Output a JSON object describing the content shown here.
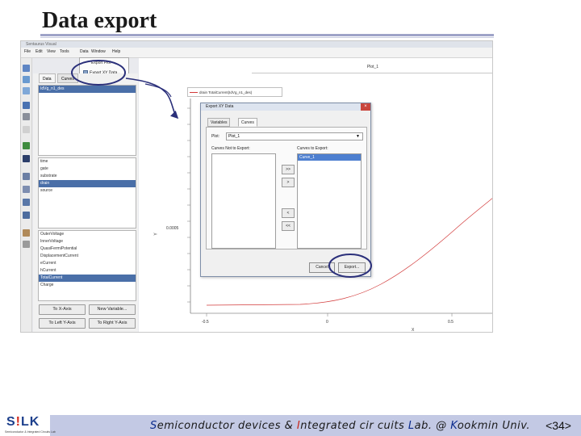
{
  "slide": {
    "title": "Data export",
    "page_number": "<34>"
  },
  "window": {
    "title": "Sentaurus Visual",
    "menu": [
      "File",
      "Edit",
      "View",
      "Tools",
      "Data",
      "Window",
      "Help"
    ],
    "data_menu": {
      "item_1": "Export Plot",
      "item_2": "Export XY Data..."
    }
  },
  "left_panel": {
    "tabs": [
      "Data",
      "Curves"
    ],
    "dataset": "IdVg_n1_des",
    "variables_a": [
      "time",
      "gate",
      "substrate",
      "drain",
      "source"
    ],
    "variables_a_selected": "drain",
    "variables_b": [
      "OuterVoltage",
      "InnerVoltage",
      "QuasiFermiPotential",
      "DisplacementCurrent",
      "eCurrent",
      "hCurrent",
      "TotalCurrent",
      "Charge"
    ],
    "variables_b_selected": "TotalCurrent",
    "buttons": {
      "to_x_axis": "To X-Axis",
      "new_variable": "New Variable...",
      "to_left_y": "To Left Y-Axis",
      "to_right_y": "To Right Y-Axis"
    }
  },
  "plot": {
    "tab_title": "Plot_1",
    "legend": "drain TotalCurrent(IdVg_n1_des)",
    "y_label": "Y",
    "x_label": "X",
    "y_tick_mid": "0.0005",
    "y_tick_zero": "0",
    "x_ticks": [
      "-0.5",
      "0",
      "0.5"
    ]
  },
  "dialog": {
    "title": "Export XY Data",
    "tabs": [
      "Variables",
      "Curves"
    ],
    "plot_label": "Plot:",
    "plot_value": "Plot_1",
    "curves_not_label": "Curves Not to Export:",
    "curves_to_label": "Curves to Export:",
    "curves_to_export": [
      "Curve_1"
    ],
    "move_buttons": [
      ">>",
      ">",
      "<",
      "<<"
    ],
    "cancel_label": "Cancel",
    "export_label": "Export..."
  },
  "footer": {
    "logo": "S!LK",
    "logo_sub": "Semiconductor & Integrated Circuits Lab",
    "caption_parts": [
      "S",
      "emiconductor devices & ",
      "I",
      "ntegrated cir cuits ",
      "L",
      "ab. @ ",
      "K",
      "ookmin Univ."
    ]
  },
  "colors": {
    "curve": "#d23a3a",
    "title_rule": "#9ea3c8",
    "footer_band": "#c3c9e4",
    "callout": "#2a2f7a",
    "selection": "#4a6fa8"
  }
}
